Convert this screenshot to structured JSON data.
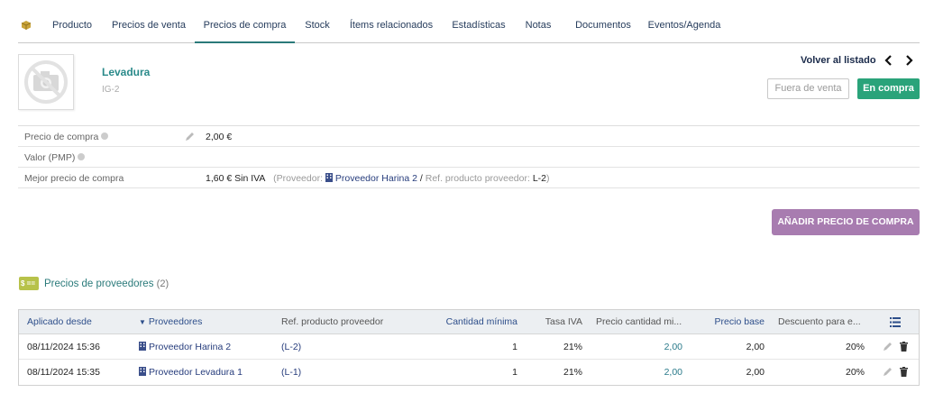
{
  "tabs": [
    {
      "label": "Producto"
    },
    {
      "label": "Precios de venta"
    },
    {
      "label": "Precios de compra"
    },
    {
      "label": "Stock"
    },
    {
      "label": "Ítems relacionados"
    },
    {
      "label": "Estadísticas"
    },
    {
      "label": "Notas"
    },
    {
      "label": "Documentos"
    },
    {
      "label": "Eventos/Agenda"
    }
  ],
  "active_tab": "Precios de compra",
  "product": {
    "name": "Levadura",
    "ref": "IG-2"
  },
  "nav": {
    "back_label": "Volver al listado"
  },
  "status": {
    "sell_label": "Fuera de venta",
    "buy_label": "En compra"
  },
  "fields": {
    "purchase_price_label": "Precio de compra",
    "purchase_price_value": "2,00 €",
    "pmp_label": "Valor (PMP)",
    "best_price_label": "Mejor precio de compra",
    "best_price_value": "1,60 € Sin IVA",
    "best_price_open": "(Proveedor:",
    "best_price_supplier": "Proveedor Harina 2",
    "best_price_sep": "/",
    "best_price_ref_label": "Ref. producto proveedor:",
    "best_price_ref": "L-2",
    "best_price_close": ")"
  },
  "add_button_label": "AÑADIR PRECIO DE COMPRA",
  "section": {
    "icon_text": "$ ==",
    "title": "Precios de proveedores",
    "count": "(2)"
  },
  "table": {
    "headers": {
      "date": "Aplicado desde",
      "supplier": "Proveedores",
      "ref": "Ref. producto proveedor",
      "min_qty": "Cantidad mínima",
      "vat": "Tasa IVA",
      "qty_price": "Precio cantidad mi...",
      "base_price": "Precio base",
      "discount": "Descuento para e..."
    },
    "rows": [
      {
        "date": "08/11/2024 15:36",
        "supplier": "Proveedor Harina 2",
        "ref": "(L-2)",
        "min_qty": "1",
        "vat": "21%",
        "qty_price": "2,00",
        "base_price": "2,00",
        "discount": "20%"
      },
      {
        "date": "08/11/2024 15:35",
        "supplier": "Proveedor Levadura 1",
        "ref": "(L-1)",
        "min_qty": "1",
        "vat": "21%",
        "qty_price": "2,00",
        "base_price": "2,00",
        "discount": "20%"
      }
    ]
  },
  "colors": {
    "accent_teal": "#2a7a7a",
    "buy_badge": "#2aa37a",
    "add_button": "#a87cb0",
    "section_icon": "#b7c24a"
  }
}
